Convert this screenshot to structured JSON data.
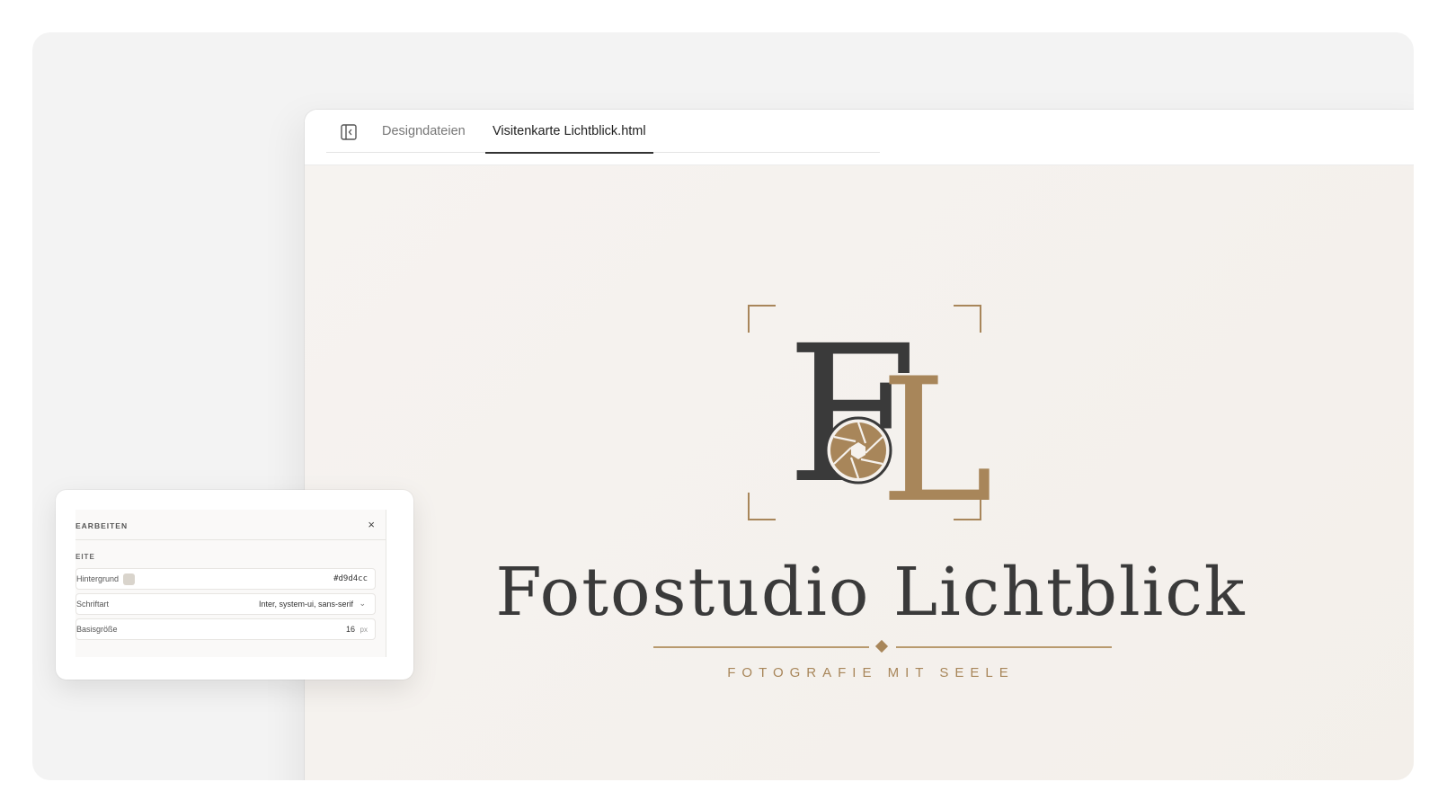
{
  "tabs": [
    {
      "label": "Designdateien"
    },
    {
      "label": "Visitenkarte Lichtblick.html"
    }
  ],
  "canvas": {
    "background": "#f4f0ec",
    "logo": {
      "letter_f": "F",
      "letter_l": "L",
      "dark": "#3a3a3a",
      "gold": "#a8865a"
    },
    "brand_name": "Fotostudio Lichtblick",
    "tagline": "FOTOGRAFIE MIT SEELE"
  },
  "edit_panel": {
    "title": "EARBEITEN",
    "close": "×",
    "section": "EITE",
    "fields": {
      "background": {
        "label": "Hintergrund",
        "value": "#d9d4cc"
      },
      "font": {
        "label": "Schriftart",
        "value": "Inter, system-ui, sans-serif"
      },
      "base_size": {
        "label": "Basisgröße",
        "value": "16",
        "unit": "px"
      }
    }
  }
}
